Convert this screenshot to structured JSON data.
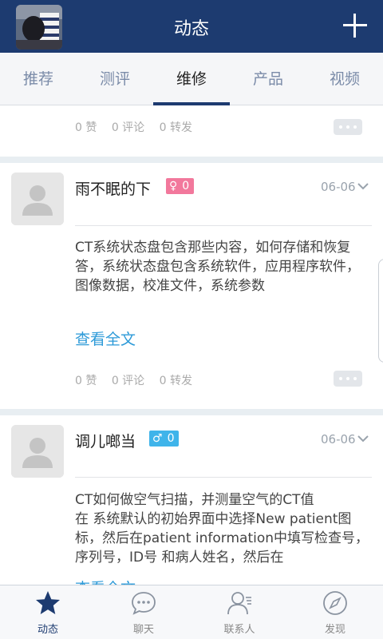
{
  "header": {
    "title": "动态"
  },
  "tabs": [
    {
      "label": "推荐"
    },
    {
      "label": "测评"
    },
    {
      "label": "维修"
    },
    {
      "label": "产品"
    },
    {
      "label": "视频"
    }
  ],
  "active_tab": "维修",
  "posts": [
    {
      "stats": {
        "likes": "0 赞",
        "comments": "0 评论",
        "shares": "0 转发"
      }
    },
    {
      "user": "雨不眠的下",
      "gender": "female",
      "badge_count": "0",
      "date": "06-06",
      "body": "CT系统状态盘包含那些内容，如何存储和恢复\n答，系统状态盘包含系统软件，应用程序软件，图像数据，校准文件，系统参数",
      "read_more": "查看全文",
      "stats": {
        "likes": "0 赞",
        "comments": "0 评论",
        "shares": "0 转发"
      }
    },
    {
      "user": "调儿啷当",
      "gender": "male",
      "badge_count": "0",
      "date": "06-06",
      "body": "CT如何做空气扫描，并测量空气的CT值\n在 系统默认的初始界面中选择New patient图标，然后在patient information中填写检查号，序列号，ID号 和病人姓名，然后在",
      "read_more": "查看全文"
    }
  ],
  "bottom_nav": [
    {
      "label": "动态",
      "icon": "star-icon",
      "active": true
    },
    {
      "label": "聊天",
      "icon": "chat-bubble-icon",
      "active": false
    },
    {
      "label": "联系人",
      "icon": "contacts-icon",
      "active": false
    },
    {
      "label": "发现",
      "icon": "compass-icon",
      "active": false
    }
  ],
  "colors": {
    "header_bg": "#1d3b70",
    "link": "#2d9ad8",
    "female_badge": "#f2789c",
    "male_badge": "#3fb4ea"
  }
}
